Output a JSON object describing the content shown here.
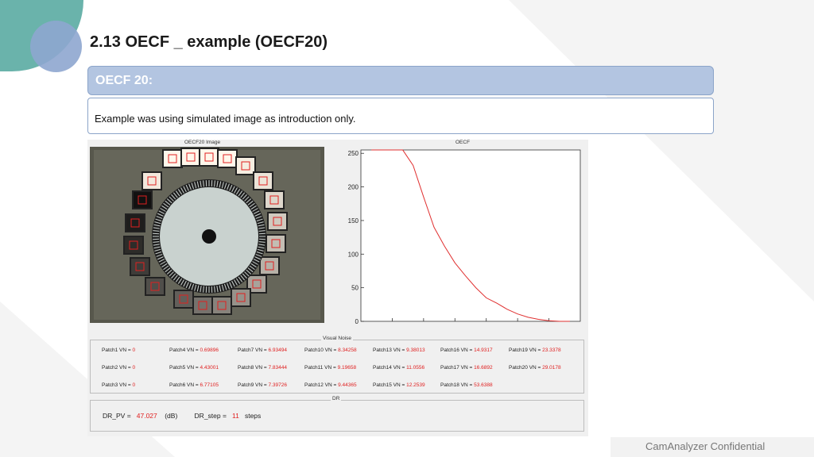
{
  "slide": {
    "title": "2.13  OECF _ example (OECF20)",
    "banner": "OECF  20:",
    "description": "Example was using simulated image as introduction only.",
    "footer": "CamAnalyzer  Confidential"
  },
  "figure": {
    "image_title": "OECF20 Image",
    "plot_title": "OECF",
    "visual_noise_title": "Visual Noise",
    "dr_title": "DR"
  },
  "chart_data": {
    "type": "line",
    "title": "OECF",
    "x": [
      1,
      2,
      3,
      4,
      5,
      6,
      7,
      8,
      9,
      10,
      11,
      12,
      13,
      14,
      15,
      16,
      17,
      18,
      19,
      20
    ],
    "y": [
      255,
      255,
      255,
      255,
      232,
      185,
      140,
      112,
      87,
      68,
      50,
      35,
      27,
      18,
      11,
      6,
      3,
      1,
      0,
      0
    ],
    "xlim": [
      0,
      21
    ],
    "ylim": [
      0,
      255
    ],
    "yticks": [
      0,
      50,
      100,
      150,
      200,
      250
    ],
    "color": "#e03030"
  },
  "visual_noise": [
    {
      "label": "Patch1 VN =",
      "value": "0"
    },
    {
      "label": "Patch2 VN =",
      "value": "0"
    },
    {
      "label": "Patch3 VN =",
      "value": "0"
    },
    {
      "label": "Patch4 VN =",
      "value": "0.69896"
    },
    {
      "label": "Patch5 VN =",
      "value": "4.43001"
    },
    {
      "label": "Patch6 VN =",
      "value": "6.77105"
    },
    {
      "label": "Patch7 VN =",
      "value": "6.93494"
    },
    {
      "label": "Patch8 VN =",
      "value": "7.83444"
    },
    {
      "label": "Patch9 VN =",
      "value": "7.39726"
    },
    {
      "label": "Patch10 VN =",
      "value": "8.34258"
    },
    {
      "label": "Patch11 VN =",
      "value": "9.19658"
    },
    {
      "label": "Patch12 VN =",
      "value": "9.44365"
    },
    {
      "label": "Patch13 VN =",
      "value": "9.38013"
    },
    {
      "label": "Patch14 VN =",
      "value": "11.0556"
    },
    {
      "label": "Patch15 VN =",
      "value": "12.2539"
    },
    {
      "label": "Patch16 VN =",
      "value": "14.9317"
    },
    {
      "label": "Patch17 VN =",
      "value": "16.6892"
    },
    {
      "label": "Patch18 VN =",
      "value": "53.6388"
    },
    {
      "label": "Patch19 VN =",
      "value": "23.3378"
    },
    {
      "label": "Patch20 VN =",
      "value": "29.0178"
    }
  ],
  "dr": {
    "pv_label": "DR_PV =",
    "pv_value": "47.027",
    "pv_unit": "(dB)",
    "step_label": "DR_step =",
    "step_value": "11",
    "step_unit": "steps"
  },
  "chart_patches": {
    "brightness": [
      255,
      255,
      255,
      255,
      245,
      235,
      222,
      208,
      195,
      182,
      168,
      150,
      135,
      118,
      98,
      80,
      62,
      45,
      30,
      18
    ]
  }
}
